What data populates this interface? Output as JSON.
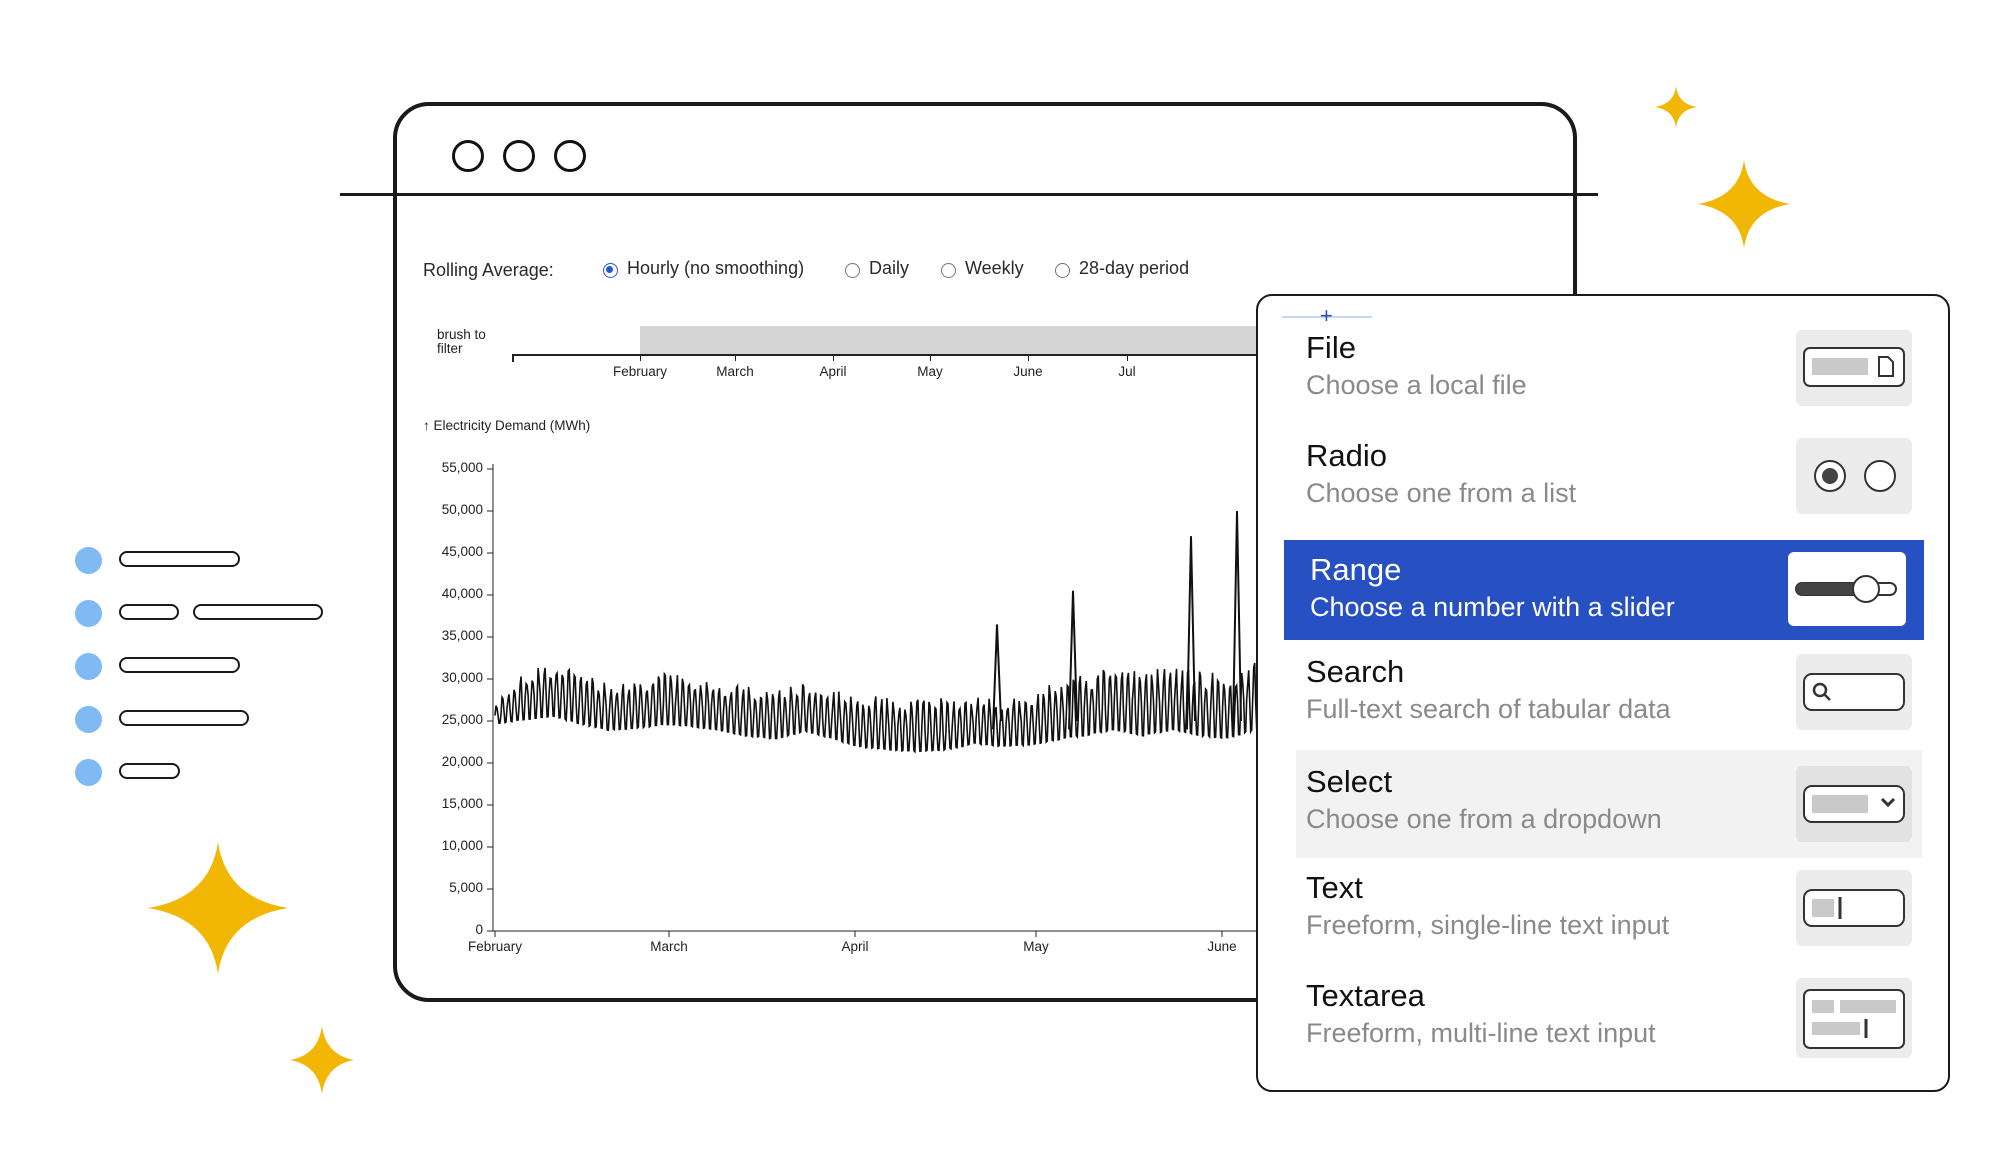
{
  "rolling_average": {
    "label": "Rolling Average:",
    "options": [
      {
        "label": "Hourly (no smoothing)",
        "selected": true
      },
      {
        "label": "Daily",
        "selected": false
      },
      {
        "label": "Weekly",
        "selected": false
      },
      {
        "label": "28-day period",
        "selected": false
      }
    ]
  },
  "brush": {
    "label_line1": "brush to",
    "label_line2": "filter",
    "months": [
      "February",
      "March",
      "April",
      "May",
      "June",
      "Jul"
    ]
  },
  "chart_data": {
    "type": "line",
    "title": "",
    "ylabel": "↑ Electricity Demand (MWh)",
    "xlabel": "",
    "x_ticks": [
      "February",
      "March",
      "April",
      "May",
      "June"
    ],
    "y_ticks": [
      "0",
      "5,000",
      "10,000",
      "15,000",
      "20,000",
      "25,000",
      "30,000",
      "35,000",
      "40,000",
      "45,000",
      "50,000",
      "55,000"
    ],
    "ylim": [
      0,
      55000
    ],
    "x_range": [
      "February",
      "June"
    ],
    "series": [
      {
        "values": [
          27000,
          30500,
          32000,
          30800,
          29500,
          29800,
          30500,
          30200,
          29800,
          29000,
          28800,
          29300,
          28600,
          28200,
          27800,
          27500,
          27600,
          27900,
          27500,
          28400,
          29600,
          30400,
          32000,
          30800,
          31500,
          30800,
          30500,
          32000,
          33500,
          32500,
          33500,
          36000,
          38000
        ],
        "low_values": [
          24500,
          24800,
          25200,
          24300,
          23600,
          23800,
          24200,
          24000,
          23500,
          22800,
          22500,
          23500,
          22500,
          21500,
          21200,
          21000,
          21200,
          22000,
          21600,
          21800,
          22400,
          22900,
          23500,
          22800,
          23500,
          22800,
          22500,
          23500,
          24500,
          24000,
          24000,
          25500,
          26000
        ],
        "peaks": [
          {
            "x": "May",
            "value": 36500
          },
          {
            "x": "May",
            "value": 40500
          },
          {
            "x": "June",
            "value": 47000
          },
          {
            "x": "June",
            "value": 50000
          }
        ]
      }
    ]
  },
  "menu": {
    "items": [
      {
        "title": "File",
        "description": "Choose a local file",
        "thumb_icon": "file-icon"
      },
      {
        "title": "Radio",
        "description": "Choose one from a list",
        "thumb_icon": "radio-icon"
      },
      {
        "title": "Range",
        "description": "Choose a number with a slider",
        "thumb_icon": "slider-icon",
        "active": true
      },
      {
        "title": "Search",
        "description": "Full-text search of tabular data",
        "thumb_icon": "search-icon"
      },
      {
        "title": "Select",
        "description": "Choose one from a dropdown",
        "thumb_icon": "select-icon",
        "hover": true
      },
      {
        "title": "Text",
        "description": "Freeform, single-line text input",
        "thumb_icon": "text-input-icon"
      },
      {
        "title": "Textarea",
        "description": "Freeform, multi-line text input",
        "thumb_icon": "textarea-icon"
      }
    ]
  },
  "colors": {
    "accent_blue": "#2750c2",
    "sparkle_yellow": "#f2b705",
    "dot_blue": "#7fbaf2",
    "radio_selected": "#2557d6"
  }
}
